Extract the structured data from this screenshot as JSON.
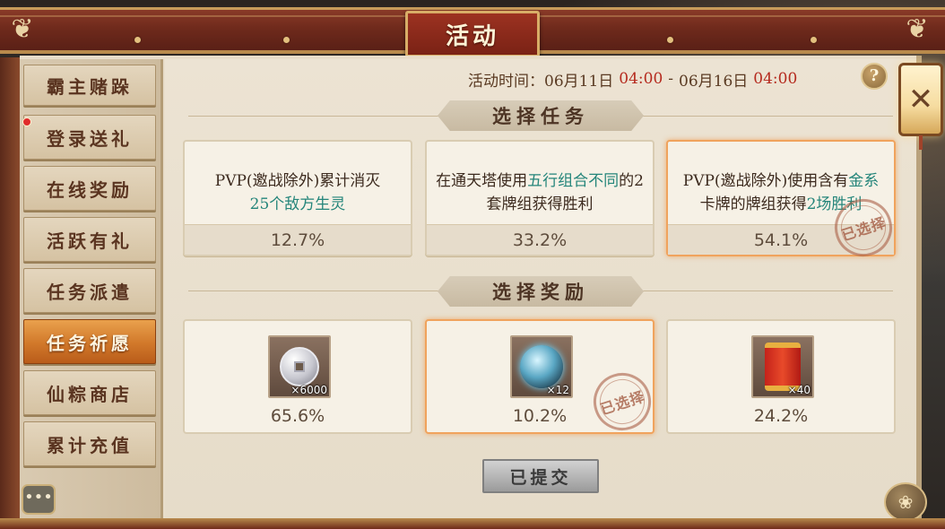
{
  "title": "活动",
  "activity_time": {
    "label": "活动时间：",
    "start_date": "06月11日",
    "start_time": "04:00",
    "separator": "-",
    "end_date": "06月16日",
    "end_time": "04:00"
  },
  "sidebar": {
    "items": [
      {
        "label": "霸主赌跺",
        "active": false,
        "badge": false
      },
      {
        "label": "登录送礼",
        "active": false,
        "badge": true
      },
      {
        "label": "在线奖励",
        "active": false,
        "badge": false
      },
      {
        "label": "活跃有礼",
        "active": false,
        "badge": false
      },
      {
        "label": "任务派遣",
        "active": false,
        "badge": false
      },
      {
        "label": "任务祈愿",
        "active": true,
        "badge": false
      },
      {
        "label": "仙粽商店",
        "active": false,
        "badge": false
      },
      {
        "label": "累计充值",
        "active": false,
        "badge": false
      }
    ]
  },
  "sections": {
    "tasks_title": "选择任务",
    "rewards_title": "选择奖励"
  },
  "tasks": [
    {
      "parts": [
        {
          "text": "PVP(邀战除外)累计消灭",
          "accent": false
        },
        {
          "text": "25个敌方生灵",
          "accent": true
        }
      ],
      "percent": "12.7%",
      "selected": false
    },
    {
      "parts": [
        {
          "text": "在通天塔使用",
          "accent": false
        },
        {
          "text": "五行组合不同",
          "accent": true
        },
        {
          "text": "的2套牌组获得胜利",
          "accent": false
        }
      ],
      "percent": "33.2%",
      "selected": false
    },
    {
      "parts": [
        {
          "text": "PVP(邀战除外)使用含有",
          "accent": false
        },
        {
          "text": "金系",
          "accent": true
        },
        {
          "text": "卡牌的牌组获得",
          "accent": false
        },
        {
          "text": "2场胜利",
          "accent": true
        }
      ],
      "percent": "54.1%",
      "selected": true
    }
  ],
  "rewards": [
    {
      "icon": "silver-coin-icon",
      "count": "×6000",
      "percent": "65.6%",
      "selected": false
    },
    {
      "icon": "spirit-orb-icon",
      "count": "×12",
      "percent": "10.2%",
      "selected": true
    },
    {
      "icon": "red-scroll-icon",
      "count": "×40",
      "percent": "24.2%",
      "selected": false
    }
  ],
  "stamp_label": "已选择",
  "submit_label": "已提交",
  "help_label": "?",
  "colors": {
    "accent_text": "#24857a",
    "time_red": "#b52a1e",
    "selected_border": "#f0a35d",
    "active_tab": "#d1782a",
    "red_badge": "#e02b2b"
  }
}
